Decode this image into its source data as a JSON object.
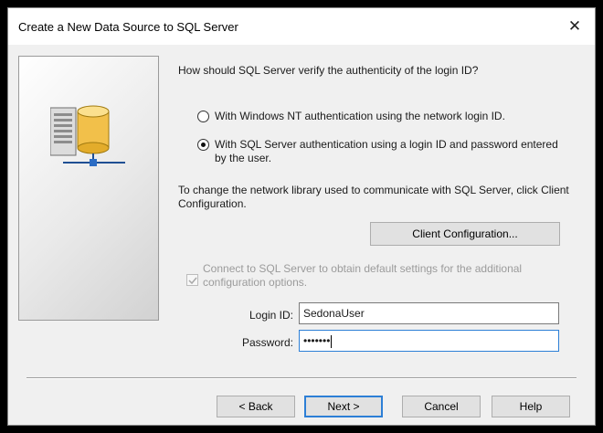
{
  "window": {
    "title": "Create a New Data Source to SQL Server",
    "close_glyph": "✕"
  },
  "question": "How should SQL Server verify the authenticity of the login ID?",
  "auth_options": [
    {
      "label": "With Windows NT authentication using the network login ID.",
      "selected": false
    },
    {
      "label": "With SQL Server authentication using a login ID and password entered by the user.",
      "selected": true
    }
  ],
  "network_text": "To change the network library used to communicate with SQL Server, click Client Configuration.",
  "client_config_button": "Client Configuration...",
  "connect_checkbox": {
    "label": "Connect to SQL Server to obtain default settings for the additional configuration options.",
    "checked": true,
    "enabled": false
  },
  "login": {
    "label": "Login ID:",
    "value": "SedonaUser"
  },
  "password": {
    "label": "Password:",
    "masked": "•••••••"
  },
  "buttons": {
    "back": "< Back",
    "next": "Next >",
    "cancel": "Cancel",
    "help": "Help"
  },
  "icons": {
    "panel": "server-database-icon",
    "close": "close-icon",
    "check": "checkmark-icon"
  }
}
